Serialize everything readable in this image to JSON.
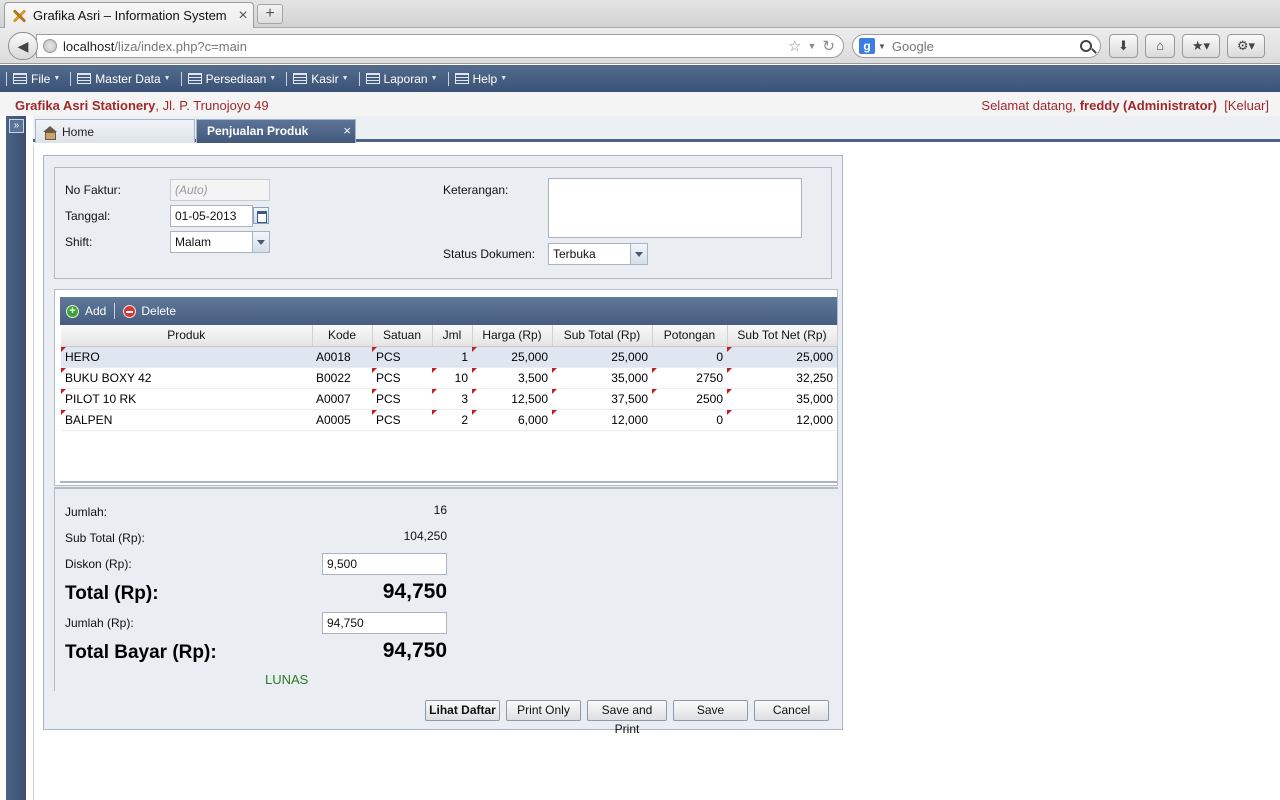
{
  "browser": {
    "tab_title": "Grafika Asri – Information System",
    "tab_close": "×",
    "new_tab": "+",
    "url_host": "localhost",
    "url_path": "/liza/index.php?c=main",
    "search_placeholder": "Google",
    "search_logo": "g"
  },
  "menu": {
    "items": [
      "File",
      "Master Data",
      "Persediaan",
      "Kasir",
      "Laporan",
      "Help"
    ]
  },
  "header": {
    "company_name": "Grafika Asri Stationery",
    "company_address": ", Jl. P. Trunojoyo 49",
    "welcome_prefix": "Selamat datang,",
    "user": "freddy (Administrator)",
    "logout": "[Keluar]"
  },
  "tabs": {
    "home": "Home",
    "active": "Penjualan Produk",
    "close": "×"
  },
  "form": {
    "no_faktur_label": "No Faktur:",
    "no_faktur_value": "(Auto)",
    "tanggal_label": "Tanggal:",
    "tanggal_value": "01-05-2013",
    "shift_label": "Shift:",
    "shift_value": "Malam",
    "keterangan_label": "Keterangan:",
    "keterangan_value": "",
    "status_label": "Status Dokumen:",
    "status_value": "Terbuka"
  },
  "grid": {
    "add_label": "Add",
    "delete_label": "Delete",
    "columns": [
      "Produk",
      "Kode",
      "Satuan",
      "Jml",
      "Harga (Rp)",
      "Sub Total (Rp)",
      "Potongan",
      "Sub Tot Net (Rp)"
    ],
    "rows": [
      {
        "produk": "HERO",
        "kode": "A0018",
        "satuan": "PCS",
        "jml": "1",
        "harga": "25,000",
        "subtotal": "25,000",
        "potongan": "0",
        "net": "25,000"
      },
      {
        "produk": "BUKU BOXY 42",
        "kode": "B0022",
        "satuan": "PCS",
        "jml": "10",
        "harga": "3,500",
        "subtotal": "35,000",
        "potongan": "2750",
        "net": "32,250"
      },
      {
        "produk": "PILOT 10 RK",
        "kode": "A0007",
        "satuan": "PCS",
        "jml": "3",
        "harga": "12,500",
        "subtotal": "37,500",
        "potongan": "2500",
        "net": "35,000"
      },
      {
        "produk": "BALPEN",
        "kode": "A0005",
        "satuan": "PCS",
        "jml": "2",
        "harga": "6,000",
        "subtotal": "12,000",
        "potongan": "0",
        "net": "12,000"
      }
    ]
  },
  "totals": {
    "jumlah_label": "Jumlah:",
    "jumlah_value": "16",
    "subtotal_label": "Sub Total (Rp):",
    "subtotal_value": "104,250",
    "diskon_label": "Diskon (Rp):",
    "diskon_value": "9,500",
    "total_label": "Total (Rp):",
    "total_value": "94,750",
    "jumlah_rp_label": "Jumlah (Rp):",
    "jumlah_rp_value": "94,750",
    "total_bayar_label": "Total Bayar (Rp):",
    "total_bayar_value": "94,750",
    "status_lunas": "LUNAS",
    "status_color": "#2f7a1d"
  },
  "buttons": {
    "lihat_daftar": "Lihat Daftar",
    "print_only": "Print Only",
    "save_and_print": "Save and Print",
    "save": "Save",
    "cancel": "Cancel"
  },
  "colors": {
    "menubar": "#465d80",
    "header_text": "#a0282d"
  }
}
